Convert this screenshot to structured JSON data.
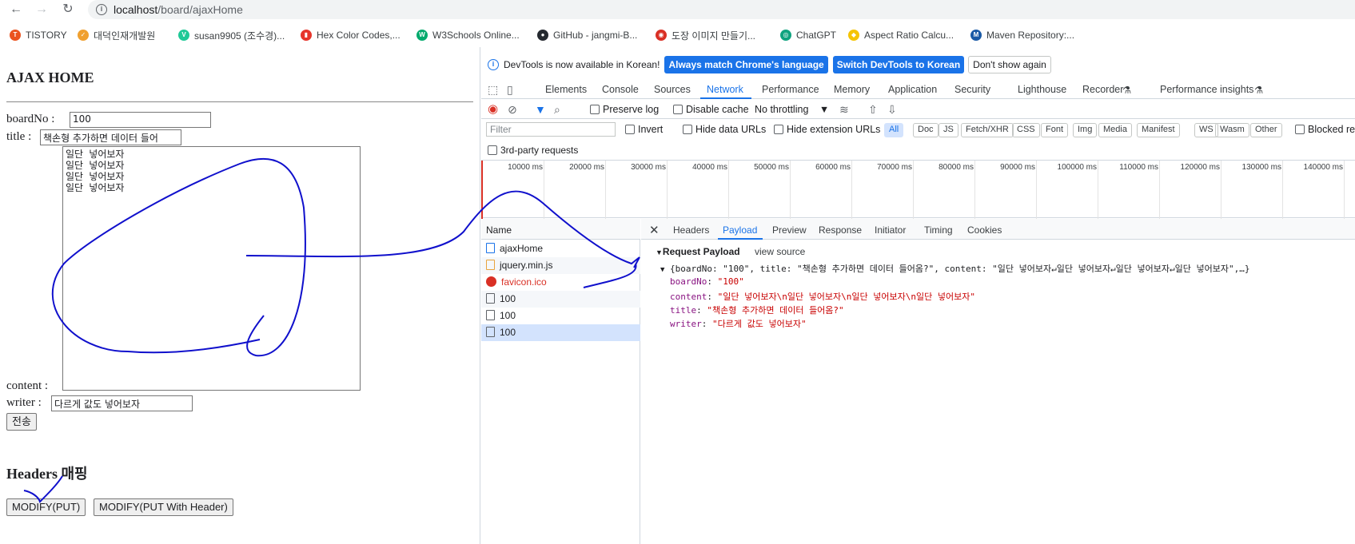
{
  "browser": {
    "url_host": "localhost",
    "url_path": "/board/ajaxHome",
    "bookmarks": [
      {
        "label": "TISTORY",
        "color": "#eb531f",
        "glyph": "T"
      },
      {
        "label": "대덕인재개발원",
        "color": "#f0a030",
        "glyph": "✓"
      },
      {
        "label": "susan9905 (조수경)...",
        "color": "#20c997",
        "glyph": "V"
      },
      {
        "label": "Hex Color Codes,...",
        "color": "#e6352b",
        "glyph": "▮"
      },
      {
        "label": "W3Schools Online...",
        "color": "#04aa6d",
        "glyph": "W"
      },
      {
        "label": "GitHub - jangmi-B...",
        "color": "#24292f",
        "glyph": "●"
      },
      {
        "label": "도장 이미지 만들기...",
        "color": "#d93025",
        "glyph": "◉"
      },
      {
        "label": "ChatGPT",
        "color": "#10a37f",
        "glyph": "◎"
      },
      {
        "label": "Aspect Ratio Calcu...",
        "color": "#f5c400",
        "glyph": "◆"
      },
      {
        "label": "Maven Repository:...",
        "color": "#1a5aa6",
        "glyph": "M"
      }
    ]
  },
  "page": {
    "title": "AJAX HOME",
    "boardNo_label": "boardNo :",
    "boardNo_value": "100",
    "title_label": "title :",
    "title_value": "책손형 추가하면 데이터 들어",
    "content_value": "일단 넣어보자\n일단 넣어보자\n일단 넣어보자\n일단 넣어보자",
    "content_label": "content :",
    "writer_label": "writer :",
    "writer_value": "다르게 값도 넣어보자",
    "submit_label": "전송",
    "headers_heading": "Headers 매핑",
    "modify_put_label": "MODIFY(PUT)",
    "modify_put_header_label": "MODIFY(PUT With Header)"
  },
  "devtools": {
    "info_text": "DevTools is now available in Korean!",
    "match_lang_btn": "Always match Chrome's language",
    "switch_korean_btn": "Switch DevTools to Korean",
    "dont_show_btn": "Don't show again",
    "tabs": [
      "Elements",
      "Console",
      "Sources",
      "Network",
      "Performance",
      "Memory",
      "Application",
      "Security",
      "Lighthouse",
      "Recorder",
      "Performance insights"
    ],
    "active_tab": "Network",
    "preserve_log": "Preserve log",
    "disable_cache": "Disable cache",
    "throttling": "No throttling",
    "filter_placeholder": "Filter",
    "invert": "Invert",
    "hide_data_urls": "Hide data URLs",
    "hide_ext_urls": "Hide extension URLs",
    "type_chips": [
      "All",
      "Doc",
      "JS",
      "Fetch/XHR",
      "CSS",
      "Font",
      "Img",
      "Media",
      "Manifest",
      "WS",
      "Wasm",
      "Other"
    ],
    "blocked": "Blocked res",
    "third_party": "3rd-party requests",
    "timeline_ticks": [
      "10000 ms",
      "20000 ms",
      "30000 ms",
      "40000 ms",
      "50000 ms",
      "60000 ms",
      "70000 ms",
      "80000 ms",
      "90000 ms",
      "100000 ms",
      "110000 ms",
      "120000 ms",
      "130000 ms",
      "140000 ms"
    ],
    "name_header": "Name",
    "requests": [
      {
        "name": "ajaxHome",
        "type": "doc"
      },
      {
        "name": "jquery.min.js",
        "type": "js"
      },
      {
        "name": "favicon.ico",
        "type": "error"
      },
      {
        "name": "100",
        "type": "xhr"
      },
      {
        "name": "100",
        "type": "xhr"
      },
      {
        "name": "100",
        "type": "xhr-selected"
      }
    ],
    "detail_tabs": [
      "Headers",
      "Payload",
      "Preview",
      "Response",
      "Initiator",
      "Timing",
      "Cookies"
    ],
    "active_detail_tab": "Payload",
    "request_payload_title": "Request Payload",
    "view_source": "view source",
    "payload_summary": "{boardNo: \"100\", title: \"책손형 추가하면 데이터 들어옴?\", content: \"일단 넣어보자↵일단 넣어보자↵일단 넣어보자↵일단 넣어보자\",…}",
    "payload_fields": [
      {
        "key": "boardNo",
        "value": "\"100\""
      },
      {
        "key": "content",
        "value": "\"일단 넣어보자\\n일단 넣어보자\\n일단 넣어보자\\n일단 넣어보자\""
      },
      {
        "key": "title",
        "value": "\"책손형 추가하면 데이터 들어옴?\""
      },
      {
        "key": "writer",
        "value": "\"다르게 값도 넣어보자\""
      }
    ]
  }
}
